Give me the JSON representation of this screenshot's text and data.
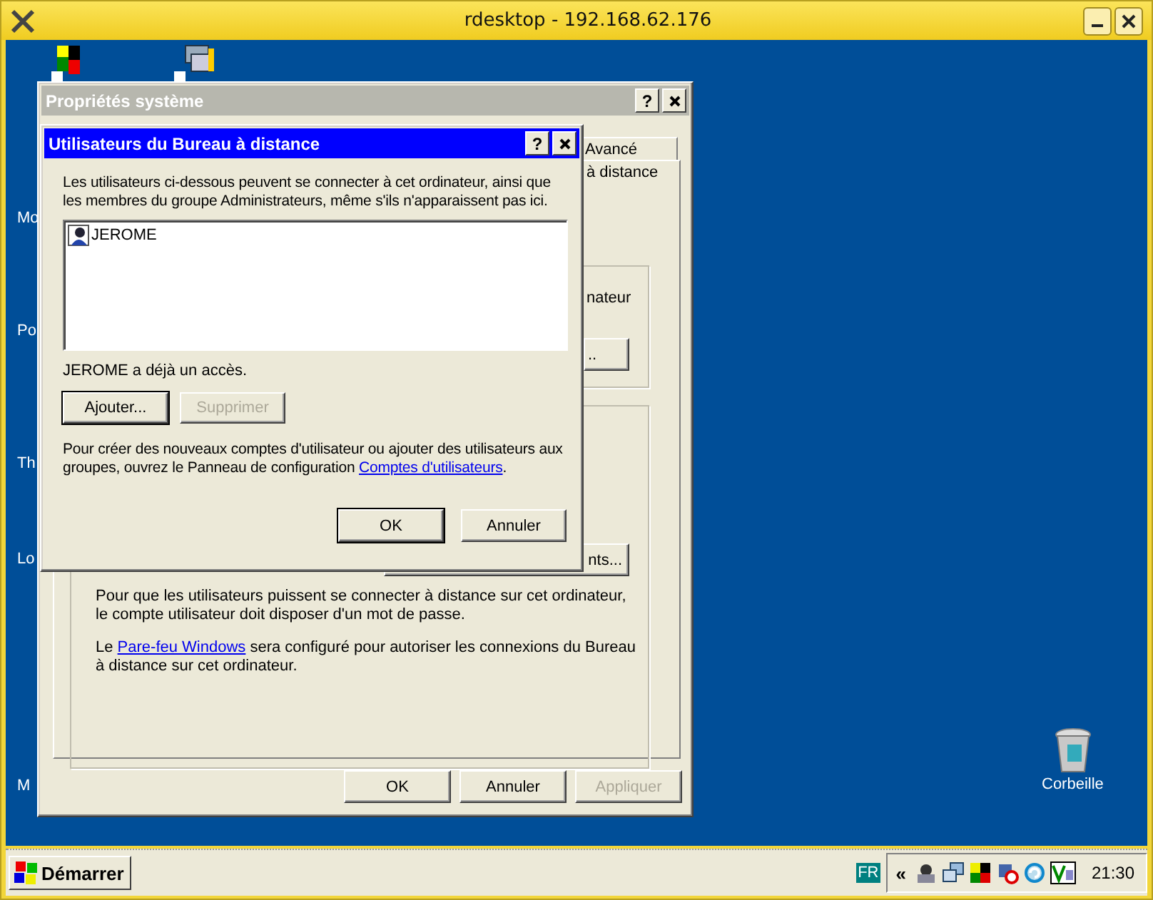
{
  "window": {
    "title": "rdesktop - 192.168.62.176",
    "active": true
  },
  "desktop": {
    "cut_labels": [
      {
        "label": "Mo"
      },
      {
        "label": "Po"
      },
      {
        "label": "Th"
      },
      {
        "label": "Lo"
      },
      {
        "label": "M"
      }
    ],
    "recycle_bin": {
      "label": "Corbeille"
    }
  },
  "system_properties": {
    "title": "Propriétés système",
    "help": "?",
    "active": false,
    "tab": {
      "label": "Avancé",
      "selected": false
    },
    "fragments": [
      "à distance",
      "nateur"
    ],
    "group_buttons": [
      "..",
      "nts..."
    ],
    "notes": [
      {
        "before": "Pour que les utilisateurs puissent se connecter à distance sur cet ordinateur, le compte utilisateur doit disposer d'un mot de passe."
      },
      {
        "before": "Le ",
        "link": "Pare-feu Windows",
        "after": " sera configuré pour autoriser les connexions du Bureau à distance sur cet ordinateur."
      }
    ],
    "buttons": [
      {
        "label": "OK",
        "disabled": false,
        "default": false
      },
      {
        "label": "Annuler",
        "disabled": false,
        "default": false
      },
      {
        "label": "Appliquer",
        "disabled": true,
        "default": false
      }
    ]
  },
  "remote_users_dialog": {
    "title": "Utilisateurs du Bureau à distance",
    "help": "?",
    "active": true,
    "intro": "Les utilisateurs ci-dessous peuvent se connecter à cet ordinateur, ainsi que les membres du groupe Administrateurs, même s'ils n'apparaissent pas ici.",
    "users": [
      {
        "name": "JEROME",
        "selected": false
      }
    ],
    "status": "JEROME a déjà un accès.",
    "list_buttons": [
      {
        "label": "Ajouter...",
        "disabled": false,
        "default": true
      },
      {
        "label": "Supprimer",
        "disabled": true,
        "default": false
      }
    ],
    "hint": {
      "before": "Pour créer des nouveaux comptes d'utilisateur ou ajouter des utilisateurs aux groupes, ouvrez le Panneau de configuration ",
      "link": "Comptes d'utilisateurs",
      "after": "."
    },
    "buttons": [
      {
        "label": "OK",
        "disabled": false,
        "default": true
      },
      {
        "label": "Annuler",
        "disabled": false,
        "default": false
      }
    ]
  },
  "taskbar": {
    "start": "Démarrer",
    "language": "FR",
    "chevron": "«",
    "clock": "21:30"
  }
}
